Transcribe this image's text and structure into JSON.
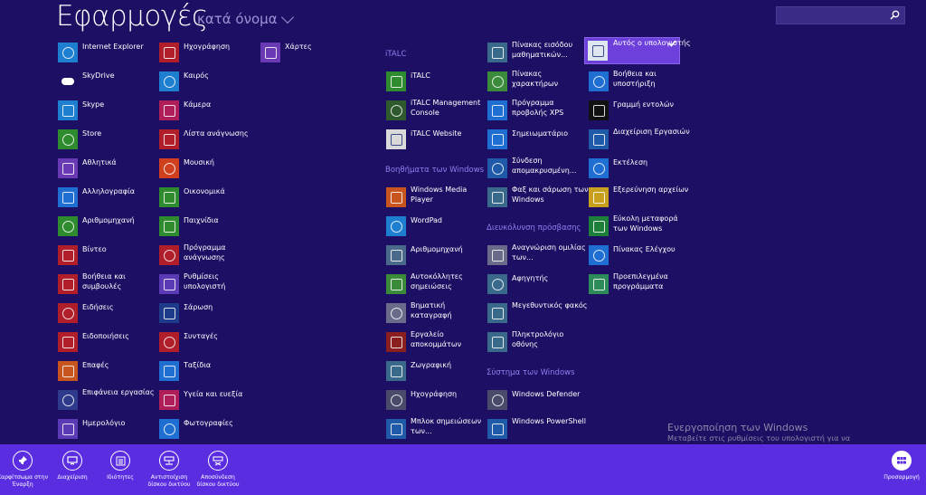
{
  "header": {
    "title": "Εφαρμογές",
    "sort": "κατά όνομα"
  },
  "search": {
    "value": "",
    "placeholder": ""
  },
  "groups": {
    "italc": "iTALC",
    "accessories": "Βοηθήματα των Windows",
    "ease": "Διευκόλυνση πρόσβασης",
    "system": "Σύστημα των Windows"
  },
  "apps": [
    {
      "label": "Internet Explorer",
      "icon": "internet-explorer-icon",
      "bg": "#1e7fd1"
    },
    {
      "label": "SkyDrive",
      "icon": "skydrive-icon",
      "bg": "#1d0f63"
    },
    {
      "label": "Skype",
      "icon": "skype-icon",
      "bg": "#1e7fd1"
    },
    {
      "label": "Store",
      "icon": "store-icon",
      "bg": "#2e8b2e"
    },
    {
      "label": "Αθλητικά",
      "icon": "trophy-icon",
      "bg": "#6a3ab5"
    },
    {
      "label": "Αλληλογραφία",
      "icon": "mail-icon",
      "bg": "#1e6fd1"
    },
    {
      "label": "Αριθμομηχανή",
      "icon": "calculator-icon",
      "bg": "#2e8b2e"
    },
    {
      "label": "Βίντεο",
      "icon": "video-icon",
      "bg": "#b01e2a"
    },
    {
      "label": "Βοήθεια και συμβουλές",
      "icon": "help-tips-icon",
      "bg": "#b01e2a"
    },
    {
      "label": "Ειδήσεις",
      "icon": "news-icon",
      "bg": "#b01e2a"
    },
    {
      "label": "Ειδοποιήσεις",
      "icon": "alarm-icon",
      "bg": "#b01e2a"
    },
    {
      "label": "Επαφές",
      "icon": "people-icon",
      "bg": "#c8541e"
    },
    {
      "label": "Επιφάνεια εργασίας",
      "icon": "desktop-icon",
      "bg": "#2e3a8b"
    },
    {
      "label": "Ημερολόγιο",
      "icon": "calendar-icon",
      "bg": "#5b3ab5"
    },
    {
      "label": "Ηχογράφηση",
      "icon": "microphone-icon",
      "bg": "#b01e2a"
    },
    {
      "label": "Καιρός",
      "icon": "weather-icon",
      "bg": "#1e7fd1"
    },
    {
      "label": "Κάμερα",
      "icon": "camera-icon",
      "bg": "#b01e5a"
    },
    {
      "label": "Λίστα ανάγνωσης",
      "icon": "reading-list-icon",
      "bg": "#b01e2a"
    },
    {
      "label": "Μουσική",
      "icon": "headphones-icon",
      "bg": "#d0401e"
    },
    {
      "label": "Οικονομικά",
      "icon": "finance-icon",
      "bg": "#2e8b2e"
    },
    {
      "label": "Παιχνίδια",
      "icon": "games-icon",
      "bg": "#2e8b2e"
    },
    {
      "label": "Πρόγραμμα ανάγνωσης",
      "icon": "reader-icon",
      "bg": "#b01e2a"
    },
    {
      "label": "Ρυθμίσεις υπολογιστή",
      "icon": "gear-icon",
      "bg": "#5b3ab5"
    },
    {
      "label": "Σάρωση",
      "icon": "scan-icon",
      "bg": "#1e3a8b"
    },
    {
      "label": "Συνταγές",
      "icon": "recipes-icon",
      "bg": "#b01e2a"
    },
    {
      "label": "Ταξίδια",
      "icon": "travel-icon",
      "bg": "#1e6fd1"
    },
    {
      "label": "Υγεία και ευεξία",
      "icon": "health-icon",
      "bg": "#b01e5a"
    },
    {
      "label": "Φωτογραφίες",
      "icon": "photos-icon",
      "bg": "#1e6fd1"
    },
    {
      "label": "Χάρτες",
      "icon": "maps-icon",
      "bg": "#6a3ab5"
    },
    {
      "label": "iTALC",
      "icon": "italc-icon",
      "bg": "#2e8b2e"
    },
    {
      "label": "iTALC Management Console",
      "icon": "italc-console-icon",
      "bg": "#2e5a2e"
    },
    {
      "label": "iTALC Website",
      "icon": "website-icon",
      "bg": "#d9d9d9"
    },
    {
      "label": "Windows Media Player",
      "icon": "media-player-icon",
      "bg": "#c8541e"
    },
    {
      "label": "WordPad",
      "icon": "wordpad-icon",
      "bg": "#1e7fd1"
    },
    {
      "label": "Αριθμομηχανή",
      "icon": "calculator-icon",
      "bg": "#4a6a8b"
    },
    {
      "label": "Αυτοκόλλητες σημειώσεις",
      "icon": "sticky-notes-icon",
      "bg": "#3a8b3a"
    },
    {
      "label": "Βηματική καταγραφή",
      "icon": "steps-recorder-icon",
      "bg": "#6a6a8b"
    },
    {
      "label": "Εργαλείο αποκομμάτων",
      "icon": "snipping-tool-icon",
      "bg": "#8b1e1e"
    },
    {
      "label": "Ζωγραφική",
      "icon": "paint-icon",
      "bg": "#3a6a8b"
    },
    {
      "label": "Ηχογράφηση",
      "icon": "microphone-icon",
      "bg": "#4a4a6a"
    },
    {
      "label": "Μπλοκ σημειώσεων των...",
      "icon": "notepad-icon",
      "bg": "#1e5aa8"
    },
    {
      "label": "Πίνακας εισόδου μαθηματικών...",
      "icon": "math-input-icon",
      "bg": "#3a6a8b"
    },
    {
      "label": "Πίνακας χαρακτήρων",
      "icon": "charmap-icon",
      "bg": "#3a8b3a"
    },
    {
      "label": "Πρόγραμμα προβολής XPS",
      "icon": "xps-viewer-icon",
      "bg": "#1e6fd1"
    },
    {
      "label": "Σημειωματάριο",
      "icon": "notepad-icon",
      "bg": "#1e6fd1"
    },
    {
      "label": "Σύνδεση απομακρυσμένη...",
      "icon": "remote-desktop-icon",
      "bg": "#1e5aa8"
    },
    {
      "label": "Φαξ και σάρωση των Windows",
      "icon": "fax-scan-icon",
      "bg": "#3a6a8b"
    },
    {
      "label": "Αναγνώριση ομιλίας των...",
      "icon": "speech-icon",
      "bg": "#6a6a8b"
    },
    {
      "label": "Αφηγητής",
      "icon": "narrator-icon",
      "bg": "#3a6a8b"
    },
    {
      "label": "Μεγεθυντικός φακός",
      "icon": "magnifier-icon",
      "bg": "#3a6a8b"
    },
    {
      "label": "Πληκτρολόγιο οθόνης",
      "icon": "on-screen-keyboard-icon",
      "bg": "#3a6a8b"
    },
    {
      "label": "Windows Defender",
      "icon": "defender-icon",
      "bg": "#4a4a6a"
    },
    {
      "label": "Windows PowerShell",
      "icon": "powershell-icon",
      "bg": "#1e5aa8"
    },
    {
      "label": "Αυτός ο υπολογιστής",
      "icon": "this-pc-icon",
      "bg": "#e0e6f0"
    },
    {
      "label": "Βοήθεια και υποστήριξη",
      "icon": "help-icon",
      "bg": "#1e6fd1"
    },
    {
      "label": "Γραμμή εντολών",
      "icon": "command-prompt-icon",
      "bg": "#111111"
    },
    {
      "label": "Διαχείριση Εργασιών",
      "icon": "task-manager-icon",
      "bg": "#1e5aa8"
    },
    {
      "label": "Εκτέλεση",
      "icon": "run-icon",
      "bg": "#1e6fd1"
    },
    {
      "label": "Εξερεύνηση αρχείων",
      "icon": "file-explorer-icon",
      "bg": "#c8a01e"
    },
    {
      "label": "Εύκολη μεταφορά των Windows",
      "icon": "easy-transfer-icon",
      "bg": "#1e7f3a"
    },
    {
      "label": "Πίνακας Ελέγχου",
      "icon": "control-panel-icon",
      "bg": "#1e6fd1"
    },
    {
      "label": "Προεπιλεγμένα προγράμματα",
      "icon": "default-programs-icon",
      "bg": "#2e8b5a"
    }
  ],
  "watermark": {
    "title": "Ενεργοποίηση των Windows",
    "subtitle": "Μεταβείτε στις ρυθμίσεις του υπολογιστή για να ενεργοποιήσετε τα Windows."
  },
  "appbar": {
    "pin": "Καρφίτσωμα στην Έναρξη",
    "manage": "Διαχείριση",
    "properties": "Ιδιότητες",
    "map_drive": "Αντιστοίχιση δίσκου δικτύου",
    "disconnect_drive": "Αποσύνδεση δίσκου δικτύου",
    "customize": "Προσαρμογή"
  },
  "colors": {
    "background": "#1d0f63",
    "appbar": "#5a2ee0",
    "selected": "#6d40dc",
    "group_header": "#8f7ff0"
  }
}
